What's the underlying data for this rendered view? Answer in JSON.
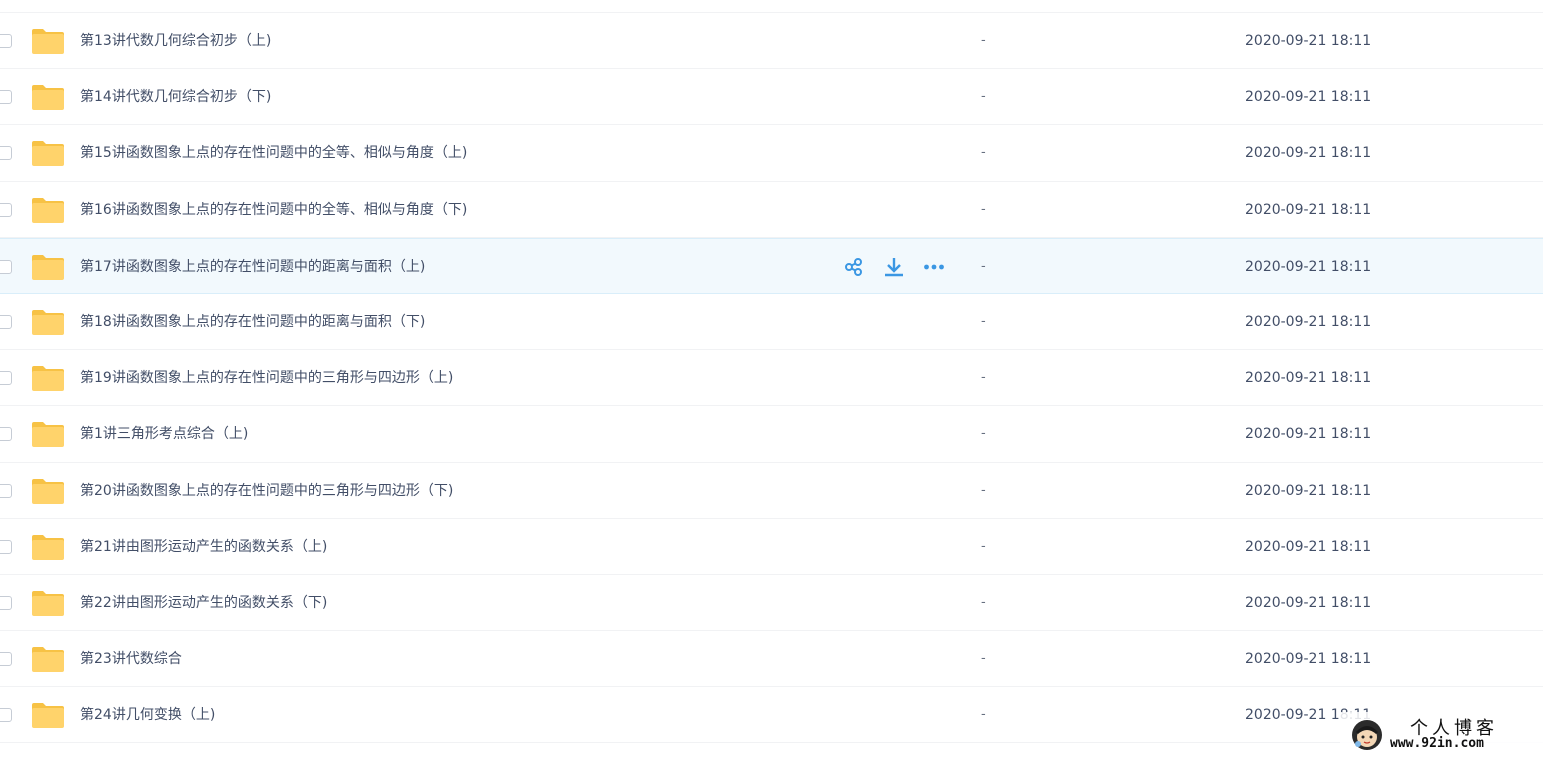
{
  "colors": {
    "folder": "#ffd36b",
    "folder_tab": "#f7c245",
    "accent": "#3b97e3",
    "text": "#424e67",
    "hover_row": "#f2f9fd"
  },
  "file_list": {
    "rows": [
      {
        "name": "第13讲代数几何综合初步（上)",
        "size": "-",
        "date": "2020-09-21 18:11"
      },
      {
        "name": "第14讲代数几何综合初步（下)",
        "size": "-",
        "date": "2020-09-21 18:11"
      },
      {
        "name": "第15讲函数图象上点的存在性问题中的全等、相似与角度（上)",
        "size": "-",
        "date": "2020-09-21 18:11"
      },
      {
        "name": "第16讲函数图象上点的存在性问题中的全等、相似与角度（下)",
        "size": "-",
        "date": "2020-09-21 18:11"
      },
      {
        "name": "第17讲函数图象上点的存在性问题中的距离与面积（上)",
        "size": "-",
        "date": "2020-09-21 18:11",
        "hovered": true
      },
      {
        "name": "第18讲函数图象上点的存在性问题中的距离与面积（下)",
        "size": "-",
        "date": "2020-09-21 18:11"
      },
      {
        "name": "第19讲函数图象上点的存在性问题中的三角形与四边形（上)",
        "size": "-",
        "date": "2020-09-21 18:11"
      },
      {
        "name": "第1讲三角形考点综合（上)",
        "size": "-",
        "date": "2020-09-21 18:11"
      },
      {
        "name": "第20讲函数图象上点的存在性问题中的三角形与四边形（下)",
        "size": "-",
        "date": "2020-09-21 18:11"
      },
      {
        "name": "第21讲由图形运动产生的函数关系（上)",
        "size": "-",
        "date": "2020-09-21 18:11"
      },
      {
        "name": "第22讲由图形运动产生的函数关系（下)",
        "size": "-",
        "date": "2020-09-21 18:11"
      },
      {
        "name": "第23讲代数综合",
        "size": "-",
        "date": "2020-09-21 18:11"
      },
      {
        "name": "第24讲几何变换（上)",
        "size": "-",
        "date": "2020-09-21 18:11"
      }
    ],
    "row_actions": [
      {
        "icon": "share-icon"
      },
      {
        "icon": "download-icon"
      },
      {
        "icon": "more-icon"
      }
    ]
  },
  "watermark": {
    "title": "个人博客",
    "url": "www.92in.com"
  }
}
